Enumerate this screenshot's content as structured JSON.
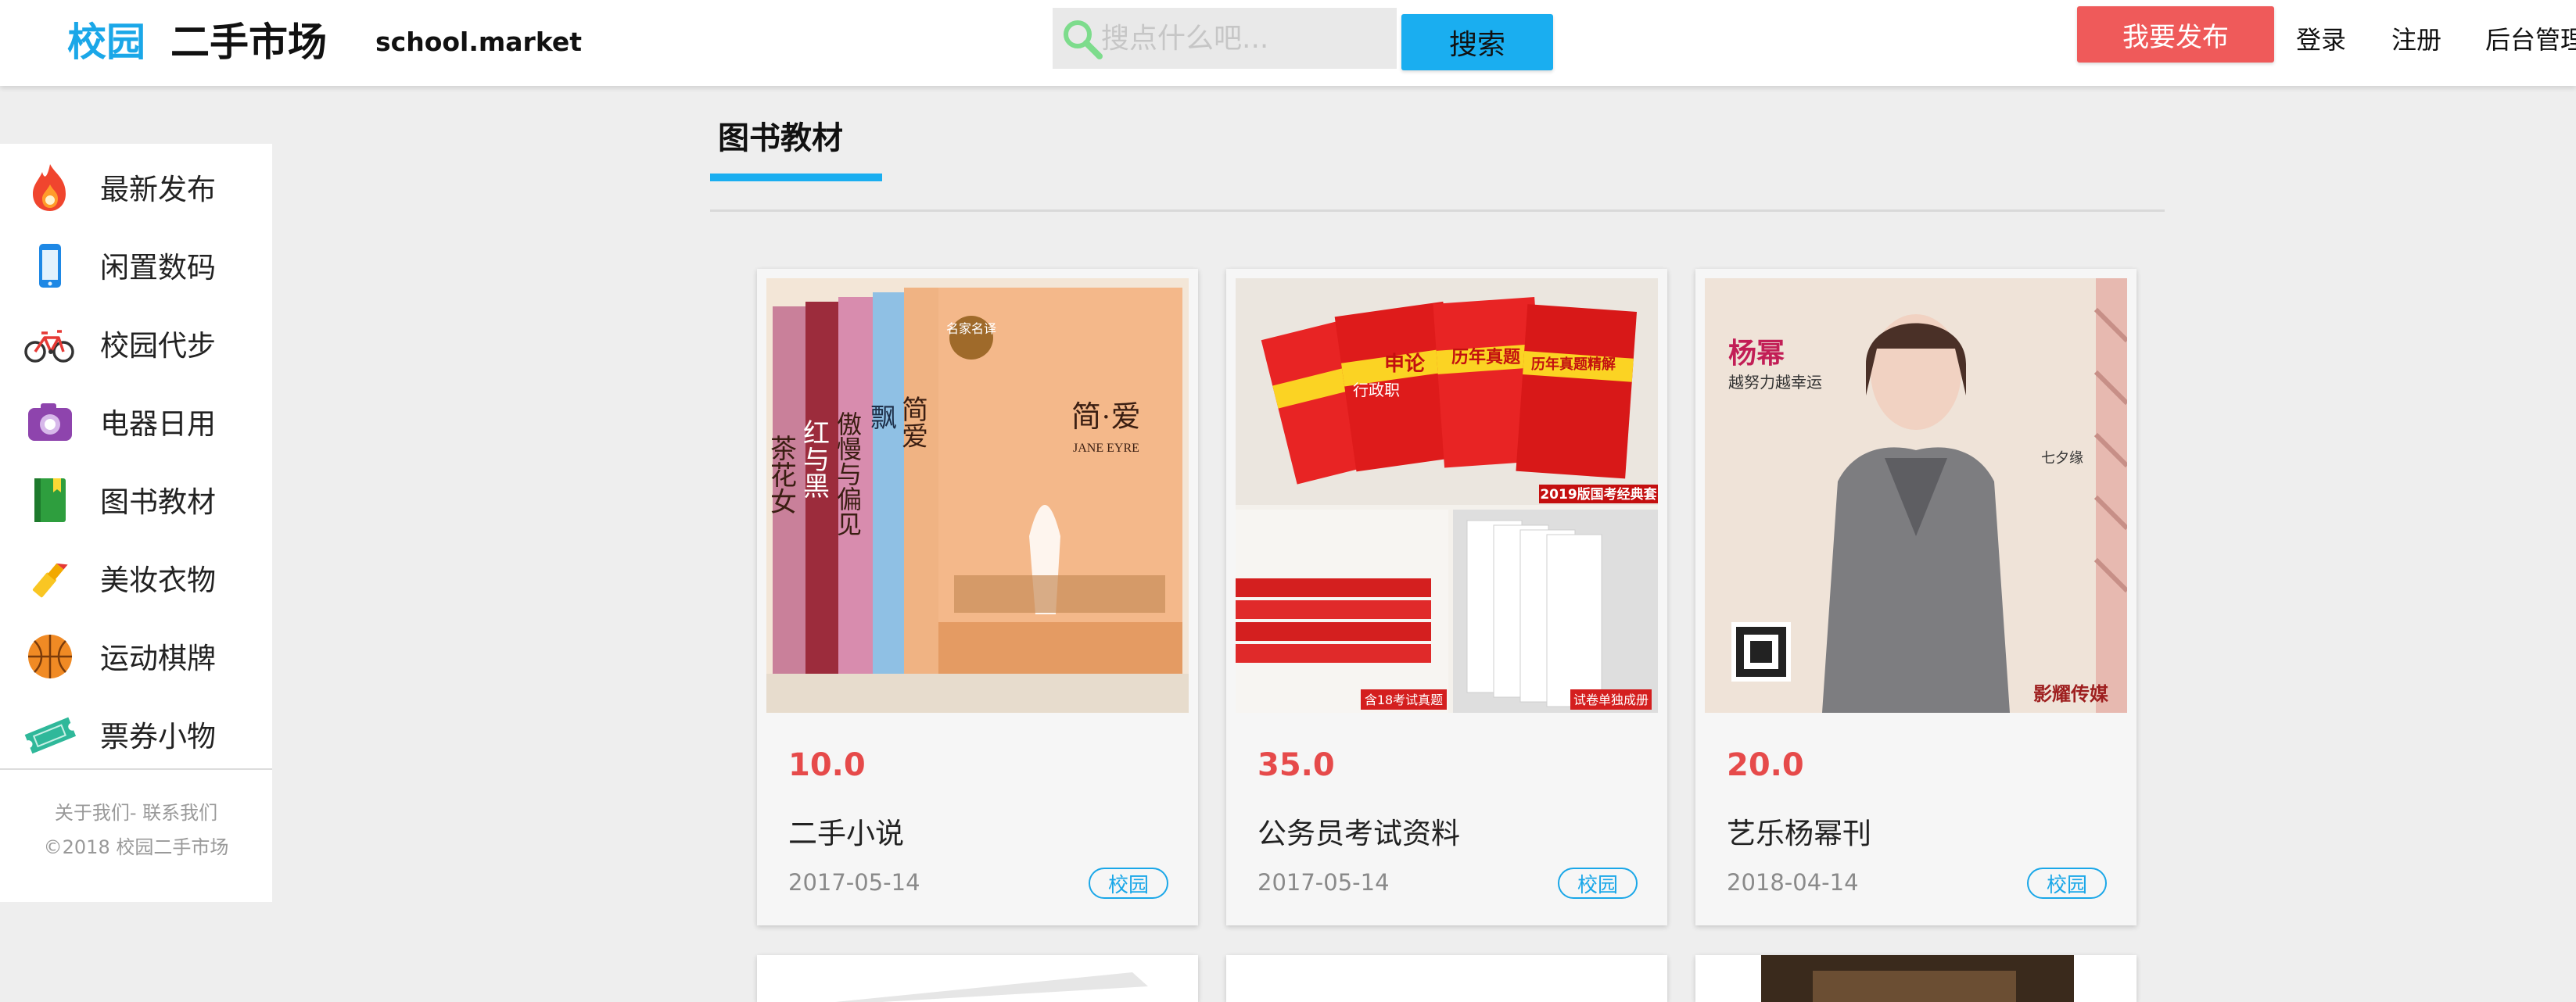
{
  "header": {
    "logo_campus": "校园",
    "logo_market": "二手市场",
    "domain": "school.market",
    "search_placeholder": "搜点什么吧...",
    "search_button": "搜索",
    "publish_button": "我要发布",
    "nav": [
      "登录",
      "注册",
      "后台管理"
    ],
    "search_icon": "search-icon"
  },
  "colors": {
    "brand_blue": "#1aaef0",
    "publish_red": "#ef5a5a",
    "price_red": "#e64a4a"
  },
  "sidebar": {
    "items": [
      {
        "label": "最新发布",
        "icon": "fire-icon"
      },
      {
        "label": "闲置数码",
        "icon": "phone-icon"
      },
      {
        "label": "校园代步",
        "icon": "bicycle-icon"
      },
      {
        "label": "电器日用",
        "icon": "camera-icon"
      },
      {
        "label": "图书教材",
        "icon": "book-icon"
      },
      {
        "label": "美妆衣物",
        "icon": "lipstick-icon"
      },
      {
        "label": "运动棋牌",
        "icon": "basketball-icon"
      },
      {
        "label": "票券小物",
        "icon": "ticket-icon"
      }
    ],
    "footer_links": "关于我们- 联系我们",
    "footer_copyright": "©2018 校园二手市场"
  },
  "main": {
    "section_title": "图书教材",
    "products": [
      {
        "price": "10.0",
        "title": "二手小说",
        "date": "2017-05-14",
        "tag": "校园",
        "image_text": {
          "badge": "名家名译",
          "spines": [
            "茶花女",
            "红与黑",
            "傲慢与偏见",
            "飘",
            "简爱"
          ],
          "cover_title": "简·爱",
          "cover_subtitle": "JANE EYRE"
        }
      },
      {
        "price": "35.0",
        "title": "公务员考试资料",
        "date": "2017-05-14",
        "tag": "校园",
        "image_text": {
          "book_titles": [
            "行政职",
            "申论",
            "历年真题",
            "历年真题精解"
          ],
          "banner_top": "2019版国考经典套",
          "banner_left": "含18考试真题",
          "banner_right": "试卷单独成册"
        }
      },
      {
        "price": "20.0",
        "title": "艺乐杨幂刊",
        "date": "2018-04-14",
        "tag": "校园",
        "image_text": {
          "name": "杨幂",
          "subtitle": "越努力越幸运",
          "side_note": "七夕缘",
          "brand": "影耀传媒"
        }
      }
    ]
  }
}
